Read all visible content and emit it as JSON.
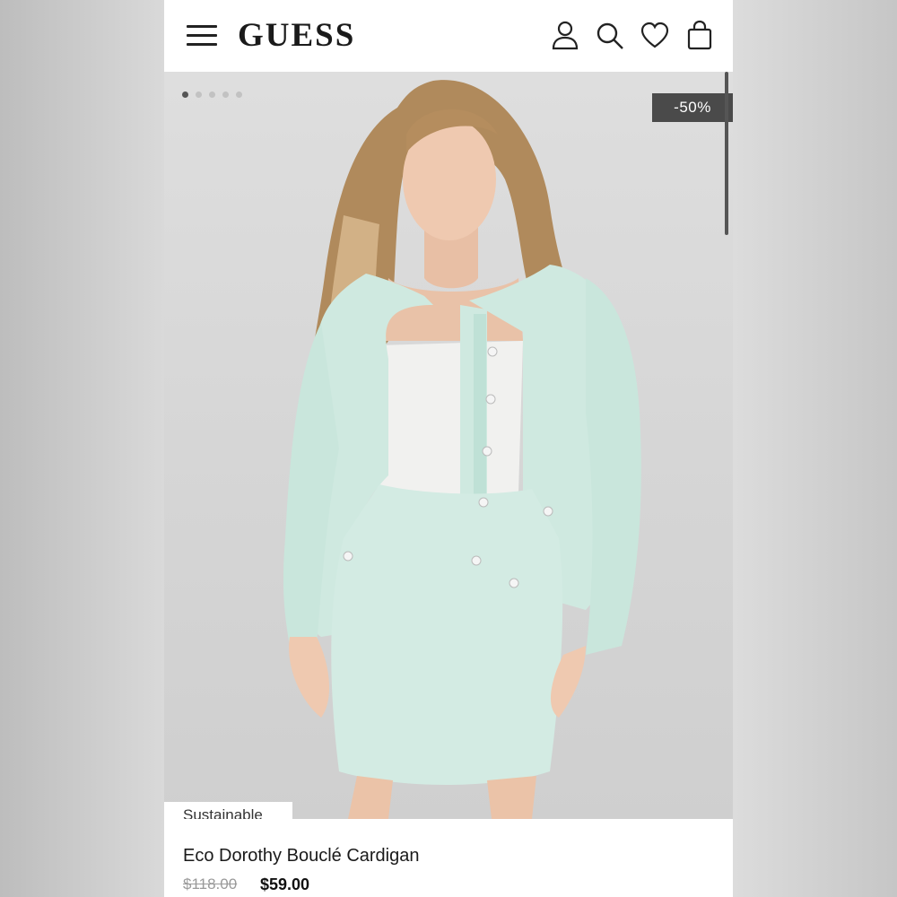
{
  "header": {
    "brand": "GUESS",
    "icons": [
      "menu-icon",
      "account-icon",
      "search-icon",
      "wishlist-icon",
      "bag-icon"
    ]
  },
  "gallery": {
    "image_count": 5,
    "active_index": 0,
    "discount_badge": "-50%",
    "sustainable_tag": "Sustainable"
  },
  "product": {
    "name": "Eco Dorothy Bouclé Cardigan",
    "original_price": "$118.00",
    "sale_price": "$59.00"
  },
  "colors": {
    "cardigan": "#cfe9e0",
    "badge": "#4a4a4a"
  }
}
